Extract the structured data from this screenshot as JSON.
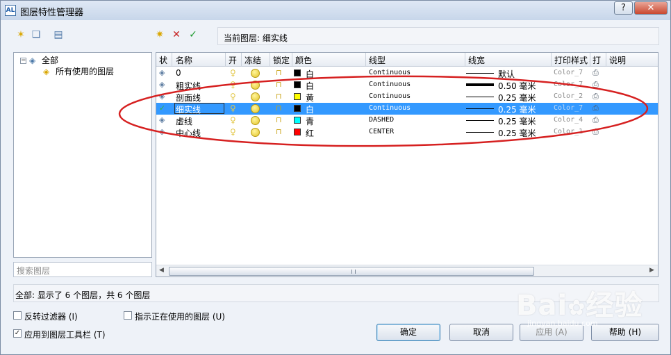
{
  "window": {
    "title": "图层特性管理器",
    "app_icon": "layer-manager-icon",
    "help_label": "?",
    "close_label": "✕"
  },
  "toolbar": {
    "icons": [
      "new-property-filter-icon",
      "new-group-filter-icon",
      "layer-states-manager-icon",
      "new-layer-icon",
      "delete-layer-icon",
      "set-current-icon"
    ],
    "current_layer_label": "当前图层: 细实线"
  },
  "tree": {
    "root_label": "全部",
    "child_label": "所有使用的图层",
    "expander": "−"
  },
  "search": {
    "placeholder": "搜索图层"
  },
  "grid": {
    "headers": [
      "状",
      "名称",
      "开",
      "冻结",
      "锁定",
      "颜色",
      "线型",
      "线宽",
      "打印样式",
      "打",
      "说明"
    ],
    "rows": [
      {
        "name": "0",
        "color_hex": "#000000",
        "color": "白",
        "linetype": "Continuous",
        "lineweight": "默认",
        "plot_style": "Color_7",
        "current": false,
        "thick": false
      },
      {
        "name": "粗实线",
        "color_hex": "#000000",
        "color": "白",
        "linetype": "Continuous",
        "lineweight": "0.50 毫米",
        "plot_style": "Color_7",
        "current": false,
        "thick": true
      },
      {
        "name": "剖面线",
        "color_hex": "#ffff00",
        "color": "黄",
        "linetype": "Continuous",
        "lineweight": "0.25 毫米",
        "plot_style": "Color_2",
        "current": false,
        "thick": false
      },
      {
        "name": "细实线",
        "color_hex": "#000000",
        "color": "白",
        "linetype": "Continuous",
        "lineweight": "0.25 毫米",
        "plot_style": "Color_7",
        "current": true,
        "thick": false
      },
      {
        "name": "虚线",
        "color_hex": "#00ffff",
        "color": "青",
        "linetype": "DASHED",
        "lineweight": "0.25 毫米",
        "plot_style": "Color_4",
        "current": false,
        "thick": false
      },
      {
        "name": "中心线",
        "color_hex": "#ff0000",
        "color": "红",
        "linetype": "CENTER",
        "lineweight": "0.25 毫米",
        "plot_style": "Color_1",
        "current": false,
        "thick": false
      }
    ],
    "status_current_glyph": "✓",
    "status_glyph": "◈"
  },
  "status_bar": {
    "text": "全部: 显示了 6 个图层，共 6 个图层"
  },
  "options": {
    "invert_filter": "反转过滤器 (I)",
    "invert_checked": false,
    "show_in_use": "指示正在使用的图层 (U)",
    "show_in_use_checked": false,
    "apply_toolbar": "应用到图层工具栏 (T)",
    "apply_toolbar_checked": true
  },
  "buttons": {
    "ok": "确定",
    "cancel": "取消",
    "apply": "应用 (A)",
    "help": "帮助 (H)"
  },
  "watermark": {
    "text": "Bai du 经验",
    "sub": "jingyan.baidu.com"
  },
  "colors": {
    "selection": "#3399ff",
    "annotation": "#d62020"
  }
}
